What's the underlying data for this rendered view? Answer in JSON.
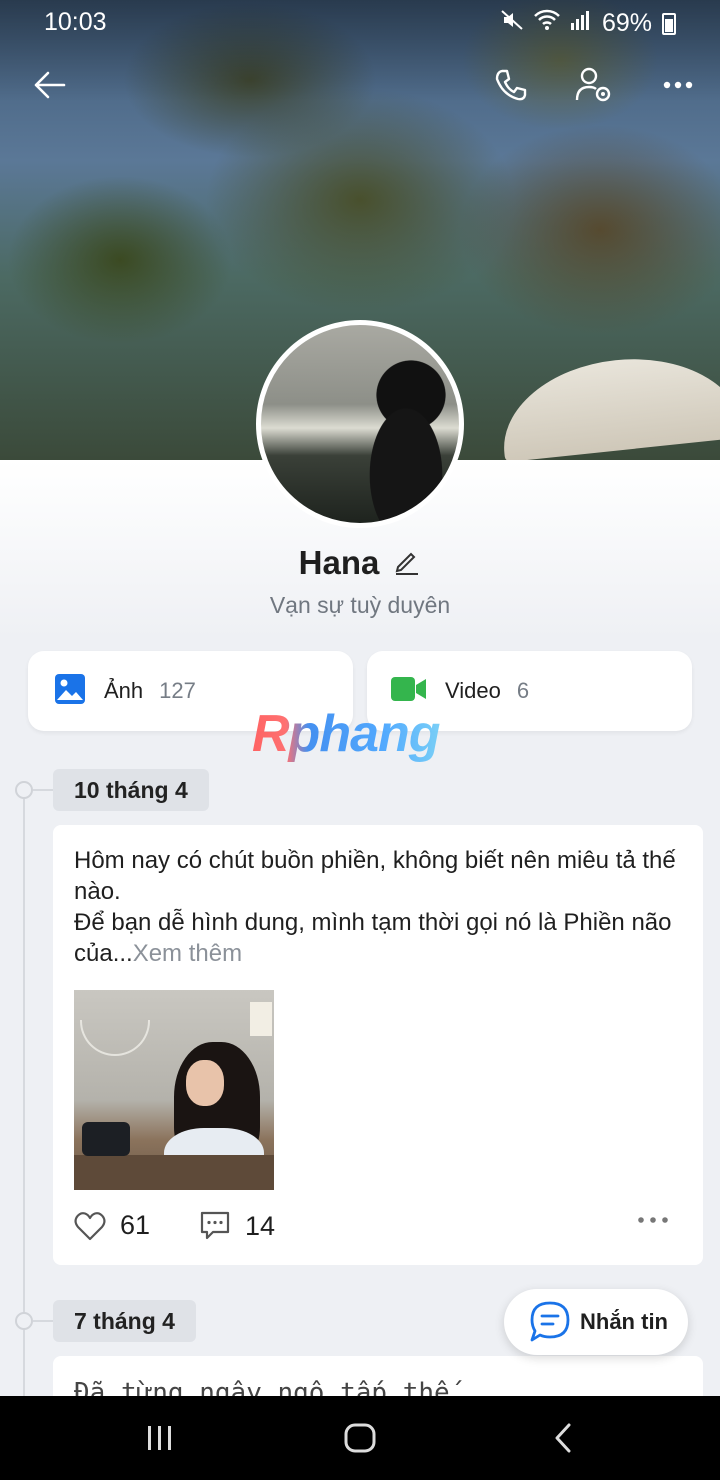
{
  "status_bar": {
    "time": "10:03",
    "battery": "69%"
  },
  "top_nav": {
    "icons": [
      "back-arrow-icon",
      "phone-icon",
      "user-settings-icon",
      "more-icon"
    ]
  },
  "profile": {
    "name": "Hana",
    "bio": "Vạn sự tuỳ duyên"
  },
  "media": {
    "photos": {
      "label": "Ảnh",
      "count": "127",
      "color": "#1a73e8"
    },
    "videos": {
      "label": "Video",
      "count": "6",
      "color": "#34b54d"
    }
  },
  "watermark": "Rphang",
  "timeline": [
    {
      "date": "10 tháng 4",
      "text_line1": "Hôm nay có chút buồn phiền, không biết nên miêu tả thế nào.",
      "text_line2": "Để bạn dễ hình dung, mình tạm thời gọi nó là Phiền não của...",
      "see_more": "Xem thêm",
      "likes": "61",
      "comments": "14"
    },
    {
      "date": "7 tháng 4",
      "text": "Đã từng ngây ngô tấp thế"
    }
  ],
  "message_button": {
    "label": "Nhắn tin"
  }
}
